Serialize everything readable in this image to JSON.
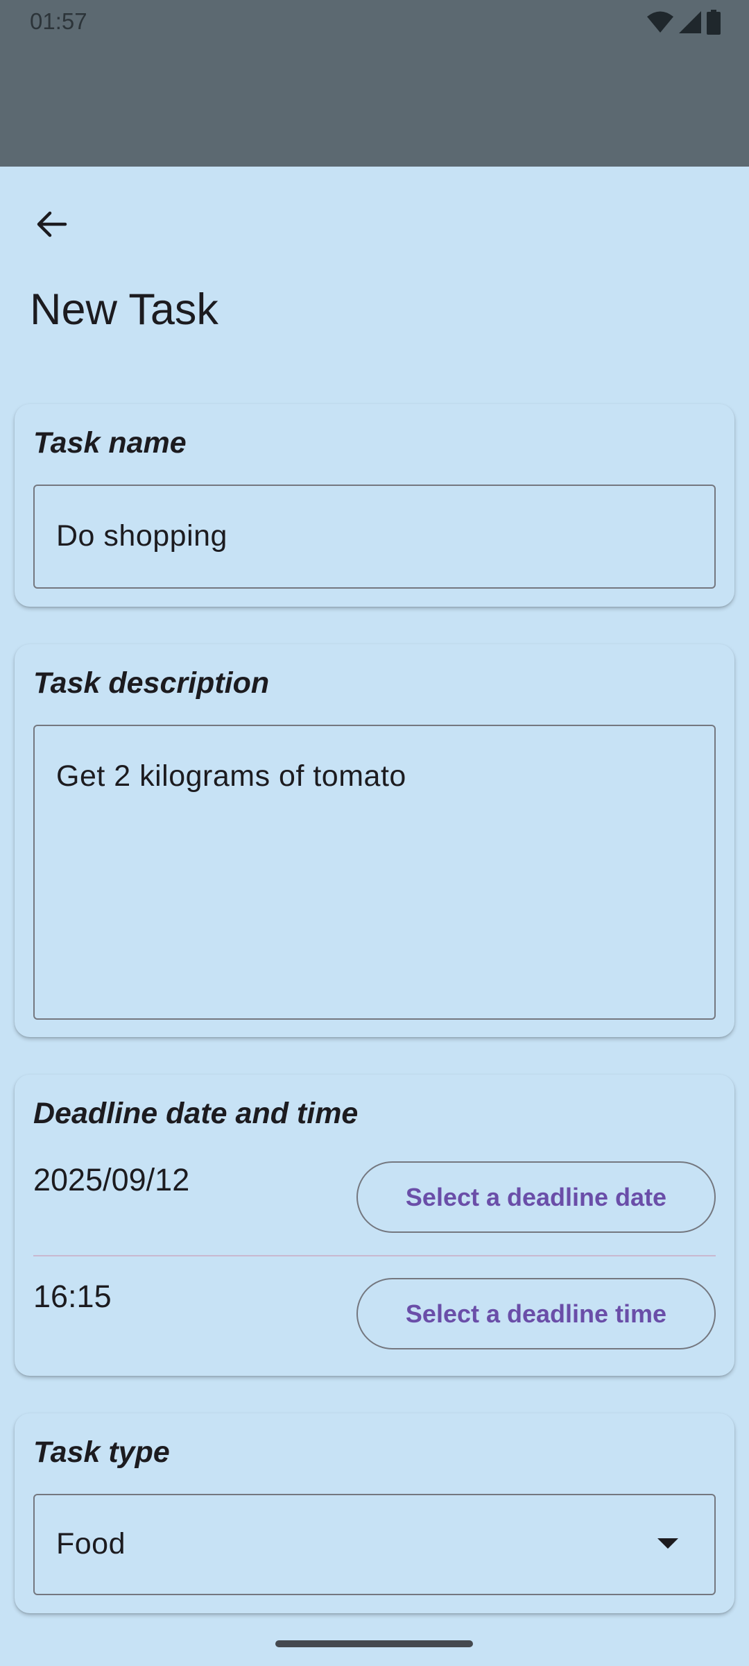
{
  "status_bar": {
    "time": "01:57",
    "icons": [
      "wifi-icon",
      "signal-icon",
      "battery-icon"
    ]
  },
  "header": {
    "back_icon": "arrow-back-icon",
    "title": "New Task"
  },
  "task_name": {
    "label": "Task name",
    "value": "Do shopping"
  },
  "task_description": {
    "label": "Task description",
    "value": "Get 2 kilograms of tomato"
  },
  "deadline": {
    "label": "Deadline date and time",
    "date_value": "2025/09/12",
    "date_button": "Select a deadline date",
    "time_value": "16:15",
    "time_button": "Select a deadline time"
  },
  "task_type": {
    "label": "Task type",
    "selected": "Food"
  },
  "colors": {
    "background": "#c7e2f5",
    "status_bar": "#5c6971",
    "accent": "#6a4ea8",
    "outline": "#74777f"
  }
}
